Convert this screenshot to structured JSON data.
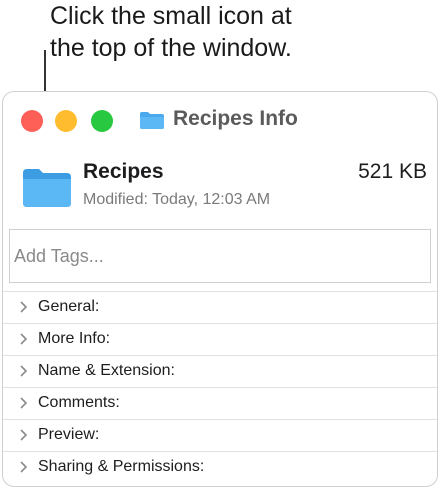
{
  "callout": {
    "line1": "Click the small icon at",
    "line2": "the top of the window."
  },
  "window": {
    "title": "Recipes Info",
    "title_icon": "folder-icon",
    "traffic_lights": {
      "close": "#fe5f57",
      "minimize": "#febc2e",
      "zoom": "#28c840"
    }
  },
  "file": {
    "icon": "folder-icon",
    "name": "Recipes",
    "size": "521 KB",
    "modified": "Modified: Today, 12:03 AM"
  },
  "tags": {
    "placeholder": "Add Tags..."
  },
  "sections": [
    {
      "label": "General:"
    },
    {
      "label": "More Info:"
    },
    {
      "label": "Name & Extension:"
    },
    {
      "label": "Comments:"
    },
    {
      "label": "Preview:"
    },
    {
      "label": "Sharing & Permissions:"
    }
  ],
  "colors": {
    "folder": "#4aa9ec",
    "accent_text": "#5b5b5b"
  }
}
